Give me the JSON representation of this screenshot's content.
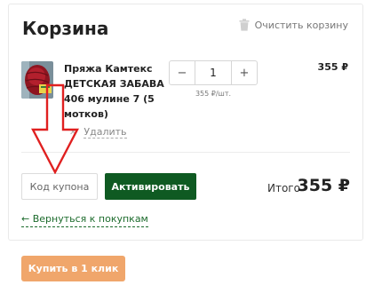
{
  "cart": {
    "title": "Корзина",
    "clear_label": "Очистить корзину",
    "icons": {
      "clear": "trash-icon",
      "remove": "close-icon",
      "back": "arrow-left-icon"
    }
  },
  "item": {
    "name": "Пряжа Камтекс ДЕТСКАЯ ЗАБАВА 406 мулине 7 (5 мотков)",
    "quantity": "1",
    "minus_label": "−",
    "plus_label": "+",
    "unit_price": "355 ₽/шт.",
    "price": "355 ₽",
    "remove_label": "Удалить",
    "remove_glyph": "✕"
  },
  "coupon": {
    "placeholder": "Код купона",
    "activate_label": "Активировать"
  },
  "total": {
    "label": "Итого",
    "value": "355 ₽"
  },
  "back_link": "← Вернуться к покупкам",
  "one_click_label": "Купить в 1 клик",
  "colors": {
    "activate_button": "#0f5a22",
    "back_link": "#1c6b2c",
    "one_click_button": "#f0a66b",
    "annotation_arrow": "#e02020"
  }
}
